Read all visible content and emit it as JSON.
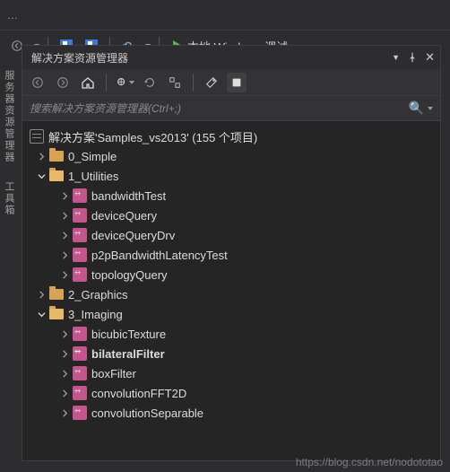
{
  "toolbar": {
    "run_label": "本地 Windows 调试"
  },
  "side_tabs": {
    "server_explorer": "服务器资源管理器",
    "toolbox": "工具箱"
  },
  "panel": {
    "title": "解决方案资源管理器",
    "search_placeholder": "搜索解决方案资源管理器(Ctrl+;)"
  },
  "tree": {
    "solution": "解决方案'Samples_vs2013' (155 个项目)",
    "folders": {
      "simple": "0_Simple",
      "utilities": "1_Utilities",
      "graphics": "2_Graphics",
      "imaging": "3_Imaging"
    },
    "utilities_items": [
      "bandwidthTest",
      "deviceQuery",
      "deviceQueryDrv",
      "p2pBandwidthLatencyTest",
      "topologyQuery"
    ],
    "imaging_items": [
      "bicubicTexture",
      "bilateralFilter",
      "boxFilter",
      "convolutionFFT2D",
      "convolutionSeparable"
    ]
  },
  "watermark": "https://blog.csdn.net/nodototao"
}
